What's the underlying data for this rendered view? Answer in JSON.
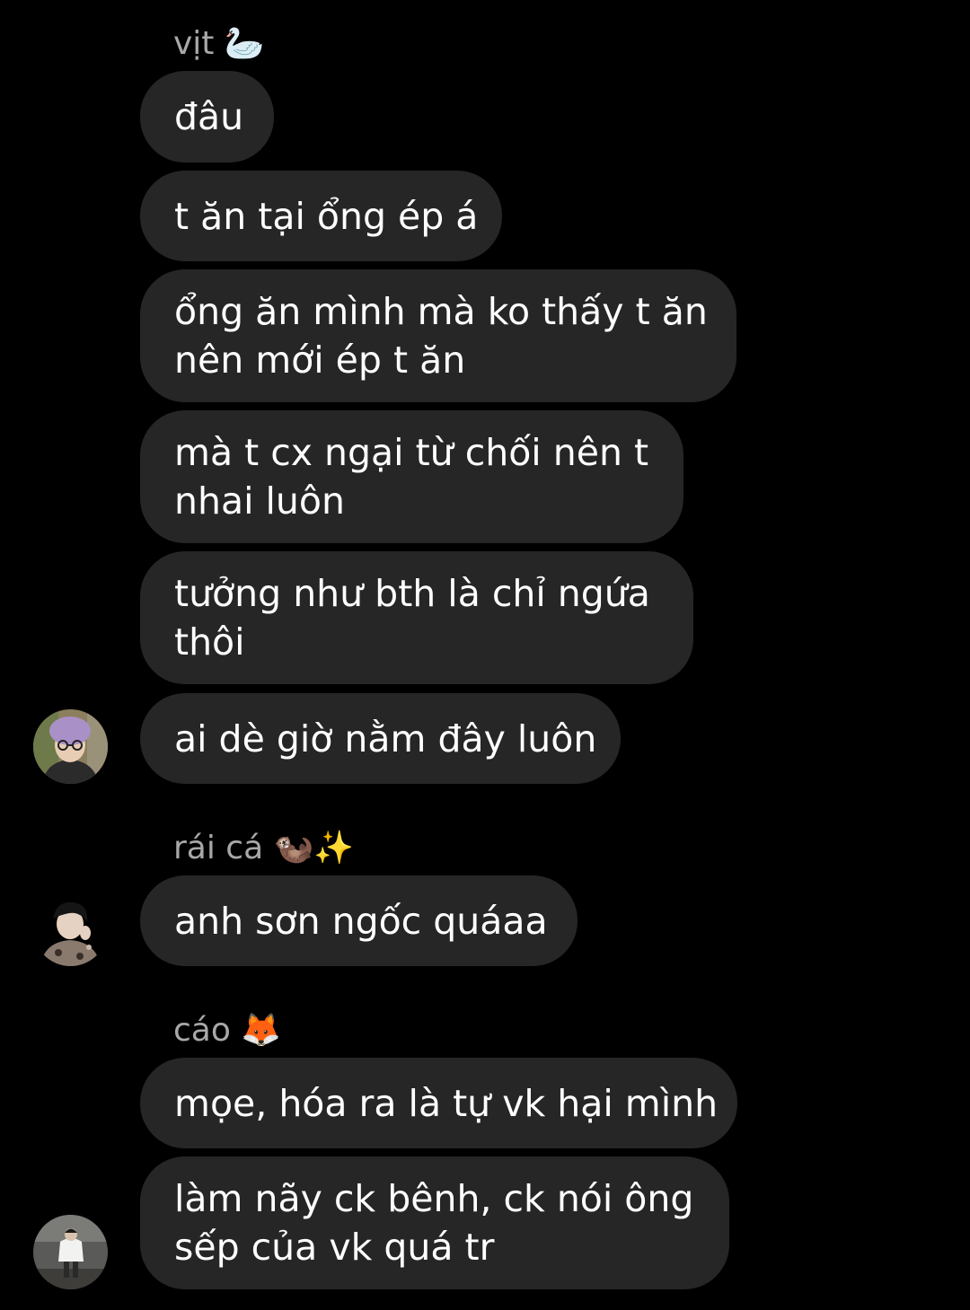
{
  "colors": {
    "background": "#000000",
    "bubble": "#262626",
    "sender_name": "#a8a8a8",
    "message_text": "#ffffff"
  },
  "groups": [
    {
      "sender": "vịt 🦢",
      "avatar_icon": "avatar-purple-beanie",
      "messages": [
        {
          "lines": [
            "đâu"
          ]
        },
        {
          "lines": [
            "t ăn tại ổng ép á"
          ]
        },
        {
          "lines": [
            "ổng ăn mình mà ko thấy t ăn",
            "nên mới ép t ăn"
          ]
        },
        {
          "lines": [
            "mà t cx ngại từ chối nên t",
            "nhai luôn"
          ]
        },
        {
          "lines": [
            "tưởng như bth là chỉ ngứa",
            "thôi"
          ]
        },
        {
          "lines": [
            "ai dè giờ nằm đây luôn"
          ]
        }
      ]
    },
    {
      "sender": "rái cá 🦦✨",
      "avatar_icon": "avatar-dark-hair-patterned-shirt",
      "messages": [
        {
          "lines": [
            "anh sơn ngốc quáaa"
          ]
        }
      ]
    },
    {
      "sender": "cáo 🦊",
      "avatar_icon": "avatar-standing-white-jacket",
      "messages": [
        {
          "lines": [
            "mọe, hóa ra là tự vk hại mình"
          ]
        },
        {
          "lines": [
            "làm nãy ck bênh, ck nói ông",
            "sếp của vk quá tr"
          ]
        }
      ]
    }
  ]
}
